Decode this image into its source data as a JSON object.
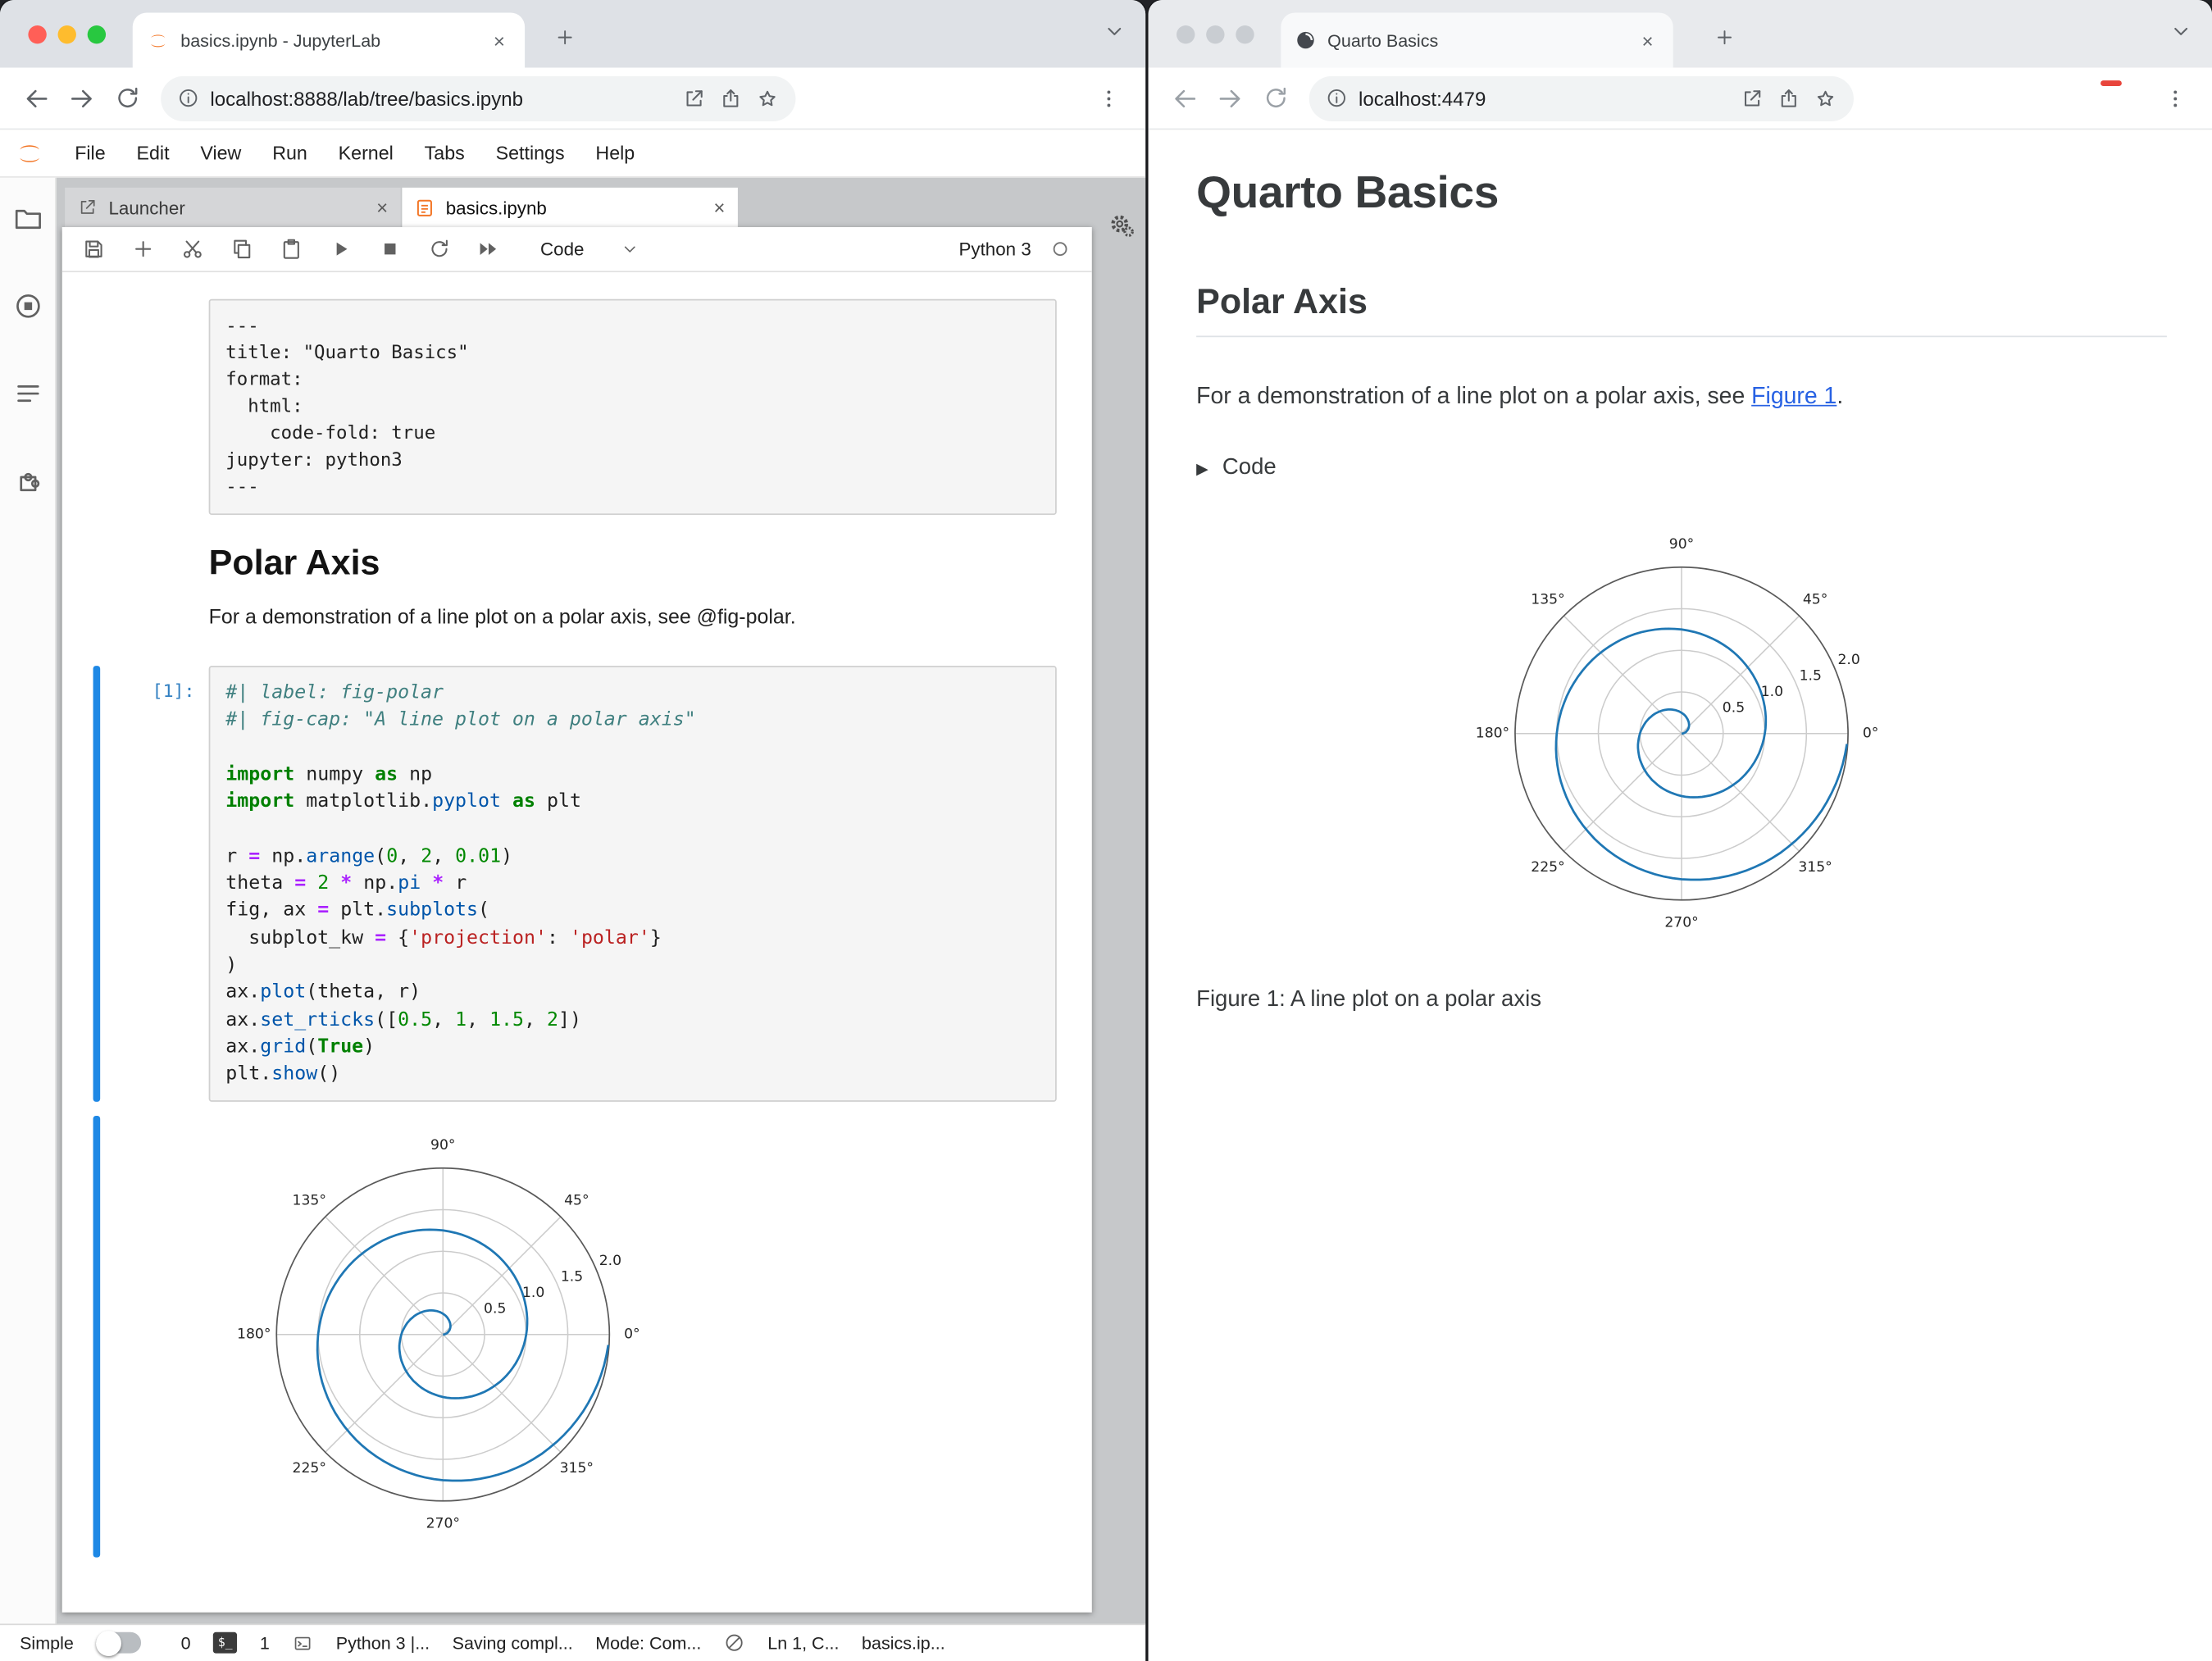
{
  "colors": {
    "jupyter_orange": "#f37626",
    "active_cell_bar": "#1e88e5",
    "link_blue": "#2761e3",
    "spiral_line": "#1f77b4",
    "traffic_red": "#ff5f57",
    "traffic_yellow": "#febc2e",
    "traffic_green": "#28c840"
  },
  "left_window": {
    "browser": {
      "tab_title": "basics.ipynb - JupyterLab",
      "url": "localhost:8888/lab/tree/basics.ipynb"
    },
    "menubar": [
      "File",
      "Edit",
      "View",
      "Run",
      "Kernel",
      "Tabs",
      "Settings",
      "Help"
    ],
    "dock": {
      "tabs": [
        "Launcher",
        "basics.ipynb"
      ]
    },
    "nb_toolbar": {
      "cell_type": "Code",
      "kernel_name": "Python 3"
    },
    "notebook": {
      "raw_lines": [
        "---",
        "title: \"Quarto Basics\"",
        "format:",
        "  html:",
        "    code-fold: true",
        "jupyter: python3",
        "---"
      ],
      "heading": "Polar Axis",
      "paragraph": "For a demonstration of a line plot on a polar axis, see @fig-polar.",
      "prompt": "[1]:",
      "code_lines": [
        [
          [
            "c",
            "#| label: fig-polar"
          ]
        ],
        [
          [
            "c",
            "#| fig-cap: \"A line plot on a polar axis\""
          ]
        ],
        [],
        [
          [
            "k",
            "import"
          ],
          [
            "t",
            " numpy "
          ],
          [
            "k",
            "as"
          ],
          [
            "t",
            " np"
          ]
        ],
        [
          [
            "k",
            "import"
          ],
          [
            "t",
            " matplotlib."
          ],
          [
            "p",
            "pyplot"
          ],
          [
            "t",
            " "
          ],
          [
            "k",
            "as"
          ],
          [
            "t",
            " plt"
          ]
        ],
        [],
        [
          [
            "t",
            "r "
          ],
          [
            "o",
            "="
          ],
          [
            "t",
            " np."
          ],
          [
            "p",
            "arange"
          ],
          [
            "t",
            "("
          ],
          [
            "n",
            "0"
          ],
          [
            "t",
            ", "
          ],
          [
            "n",
            "2"
          ],
          [
            "t",
            ", "
          ],
          [
            "n",
            "0.01"
          ],
          [
            "t",
            ")"
          ]
        ],
        [
          [
            "t",
            "theta "
          ],
          [
            "o",
            "="
          ],
          [
            "t",
            " "
          ],
          [
            "n",
            "2"
          ],
          [
            "t",
            " "
          ],
          [
            "o",
            "*"
          ],
          [
            "t",
            " np."
          ],
          [
            "p",
            "pi"
          ],
          [
            "t",
            " "
          ],
          [
            "o",
            "*"
          ],
          [
            "t",
            " r"
          ]
        ],
        [
          [
            "t",
            "fig, ax "
          ],
          [
            "o",
            "="
          ],
          [
            "t",
            " plt."
          ],
          [
            "p",
            "subplots"
          ],
          [
            "t",
            "("
          ]
        ],
        [
          [
            "t",
            "  subplot_kw "
          ],
          [
            "o",
            "="
          ],
          [
            "t",
            " {"
          ],
          [
            "s",
            "'projection'"
          ],
          [
            "t",
            ": "
          ],
          [
            "s",
            "'polar'"
          ],
          [
            "t",
            "}"
          ]
        ],
        [
          [
            "t",
            ")"
          ]
        ],
        [
          [
            "t",
            "ax."
          ],
          [
            "p",
            "plot"
          ],
          [
            "t",
            "(theta, r)"
          ]
        ],
        [
          [
            "t",
            "ax."
          ],
          [
            "p",
            "set_rticks"
          ],
          [
            "t",
            "(["
          ],
          [
            "n",
            "0.5"
          ],
          [
            "t",
            ", "
          ],
          [
            "n",
            "1"
          ],
          [
            "t",
            ", "
          ],
          [
            "n",
            "1.5"
          ],
          [
            "t",
            ", "
          ],
          [
            "n",
            "2"
          ],
          [
            "t",
            "])"
          ]
        ],
        [
          [
            "t",
            "ax."
          ],
          [
            "p",
            "grid"
          ],
          [
            "t",
            "("
          ],
          [
            "k",
            "True"
          ],
          [
            "t",
            ")"
          ]
        ],
        [
          [
            "t",
            "plt."
          ],
          [
            "p",
            "show"
          ],
          [
            "t",
            "()"
          ]
        ]
      ]
    },
    "statusbar": {
      "simple": "Simple",
      "count": "0",
      "terminals": "1",
      "kernel": "Python 3 |...",
      "saving": "Saving compl...",
      "mode": "Mode: Com...",
      "position": "Ln 1, C...",
      "filename": "basics.ip..."
    }
  },
  "right_window": {
    "browser": {
      "tab_title": "Quarto Basics",
      "url": "localhost:4479"
    },
    "page": {
      "title": "Quarto Basics",
      "section": "Polar Axis",
      "paragraph_before_link": "For a demonstration of a line plot on a polar axis, see ",
      "link_text": "Figure 1",
      "paragraph_after_link": ".",
      "code_summary": "Code",
      "caption": "Figure 1: A line plot on a polar axis"
    }
  },
  "chart_data": {
    "type": "line",
    "projection": "polar",
    "description": "Archimedean spiral: r from 0 to 2 (step 0.01), theta = 2*pi*r, two full revolutions",
    "r": {
      "start": 0,
      "end": 2,
      "step": 0.01
    },
    "theta_formula": "2 * pi * r",
    "r_max": 2.0,
    "r_ticks": [
      0.5,
      1.0,
      1.5,
      2.0
    ],
    "r_tick_labels": [
      "0.5",
      "1.0",
      "1.5",
      "2.0"
    ],
    "theta_ticks_deg": [
      0,
      45,
      90,
      135,
      180,
      225,
      270,
      315
    ],
    "theta_tick_labels": [
      "0°",
      "45°",
      "90°",
      "135°",
      "180°",
      "225°",
      "270°",
      "315°"
    ],
    "r_label_angle_deg": 22.5,
    "grid": true,
    "line_color": "#1f77b4",
    "grid_color": "#cccccc",
    "spine_color": "#595959",
    "caption": "A line plot on a polar axis",
    "label": "fig-polar"
  }
}
